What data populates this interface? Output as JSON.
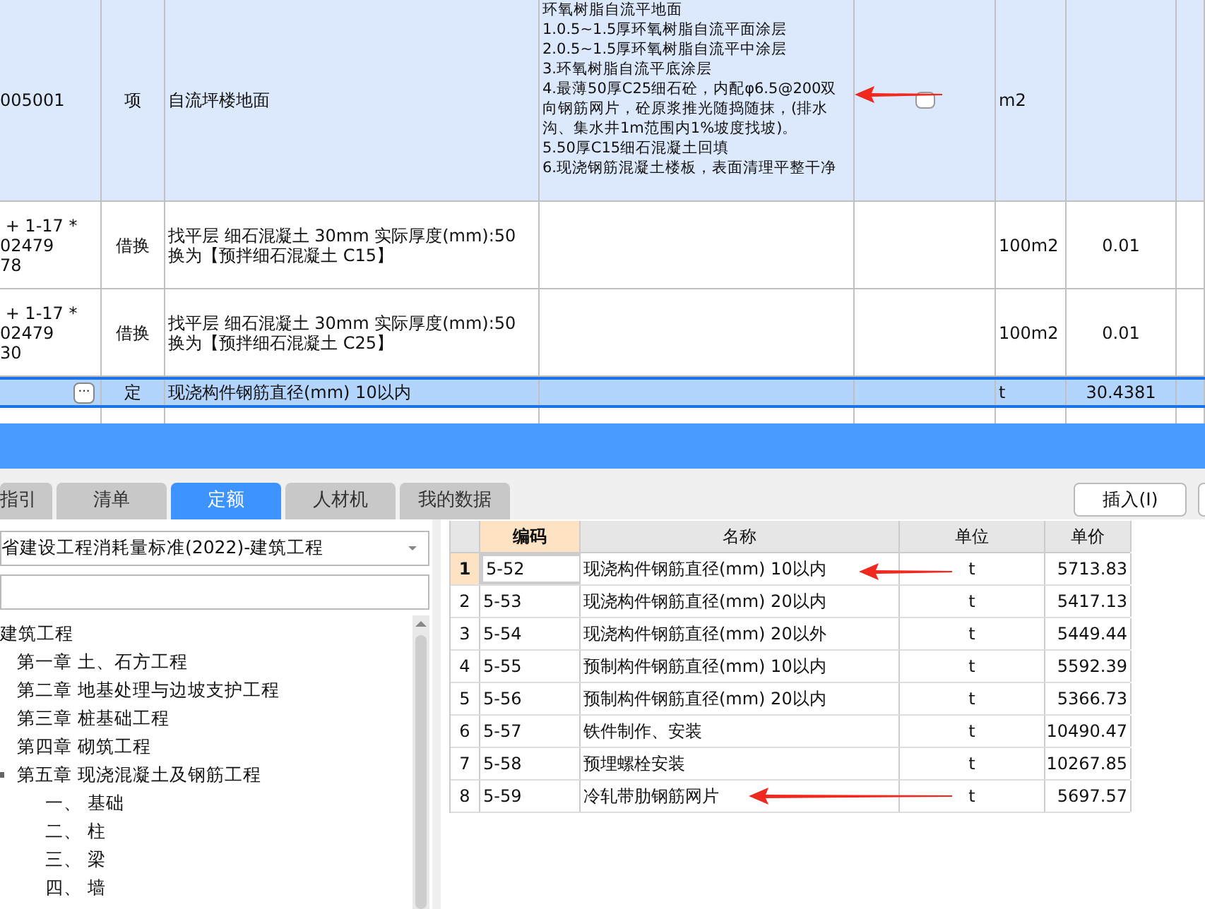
{
  "bill_rows": [
    {
      "code": "005001",
      "type": "项",
      "name": "自流坪楼地面",
      "features": "环氧树脂自流平地面\n1.0.5~1.5厚环氧树脂自流平面涂层\n2.0.5~1.5厚环氧树脂自流平中涂层\n3.环氧树脂自流平底涂层\n4.最薄50厚C25细石砼，内配φ6.5@200双向钢筋网片，砼原浆推光随捣随抹，(排水沟、集水井1m范围内1%坡度找坡)。\n5.50厚C15细石混凝土回填\n6.现浇钢筋混凝土楼板，表面清理平整干净",
      "checked": false,
      "unit": "m2",
      "quantity": "",
      "selected": false,
      "kind": "item"
    },
    {
      "code": " + 1-17 *\n02479\n78",
      "type": "借换",
      "name": "找平层 细石混凝土 30mm  实际厚度(mm):50  换为【预拌细石混凝土 C15】",
      "unit": "100m2",
      "quantity": "0.01",
      "selected": false,
      "kind": "quota"
    },
    {
      "code": " + 1-17 *\n02479\n30",
      "type": "借换",
      "name": "找平层 细石混凝土 30mm  实际厚度(mm):50  换为【预拌细石混凝土 C25】",
      "unit": "100m2",
      "quantity": "0.01",
      "selected": false,
      "kind": "quota"
    },
    {
      "code": "",
      "more": "···",
      "type": "定",
      "name": "现浇构件钢筋直径(mm) 10以内",
      "unit": "t",
      "quantity": "30.4381",
      "selected": true,
      "kind": "quota"
    }
  ],
  "tabs": [
    {
      "label": "指引",
      "selected": false
    },
    {
      "label": "清单",
      "selected": false
    },
    {
      "label": "定额",
      "selected": true
    },
    {
      "label": "人材机",
      "selected": false
    },
    {
      "label": "我的数据",
      "selected": false
    }
  ],
  "insert_button": "插入(I)",
  "library_select": "省建设工程消耗量标准(2022)-建筑工程",
  "tree": [
    {
      "label": "建筑工程",
      "children": [
        {
          "label": "第一章 土、石方工程"
        },
        {
          "label": "第二章 地基处理与边坡支护工程"
        },
        {
          "label": "第三章 桩基础工程"
        },
        {
          "label": "第四章 砌筑工程"
        },
        {
          "label": "第五章 现浇混凝土及钢筋工程",
          "expanded": true,
          "children": [
            {
              "label": "一、 基础"
            },
            {
              "label": "二、 柱"
            },
            {
              "label": "三、 梁"
            },
            {
              "label": "四、 墙"
            }
          ]
        }
      ]
    }
  ],
  "quota_table": {
    "columns": [
      "编码",
      "名称",
      "单位",
      "单价"
    ],
    "rows": [
      {
        "no": "1",
        "code": "5-52",
        "name": "现浇构件钢筋直径(mm) 10以内",
        "unit": "t",
        "price": "5713.83",
        "selected": true
      },
      {
        "no": "2",
        "code": "5-53",
        "name": "现浇构件钢筋直径(mm) 20以内",
        "unit": "t",
        "price": "5417.13",
        "selected": false
      },
      {
        "no": "3",
        "code": "5-54",
        "name": "现浇构件钢筋直径(mm) 20以外",
        "unit": "t",
        "price": "5449.44",
        "selected": false
      },
      {
        "no": "4",
        "code": "5-55",
        "name": "预制构件钢筋直径(mm) 10以内",
        "unit": "t",
        "price": "5592.39",
        "selected": false
      },
      {
        "no": "5",
        "code": "5-56",
        "name": "预制构件钢筋直径(mm) 20以内",
        "unit": "t",
        "price": "5366.73",
        "selected": false
      },
      {
        "no": "6",
        "code": "5-57",
        "name": "铁件制作、安装",
        "unit": "t",
        "price": "10490.47",
        "selected": false
      },
      {
        "no": "7",
        "code": "5-58",
        "name": "预埋螺栓安装",
        "unit": "t",
        "price": "10267.85",
        "selected": false
      },
      {
        "no": "8",
        "code": "5-59",
        "name": "冷轧带肋钢筋网片",
        "unit": "t",
        "price": "5697.57",
        "selected": false
      }
    ]
  }
}
